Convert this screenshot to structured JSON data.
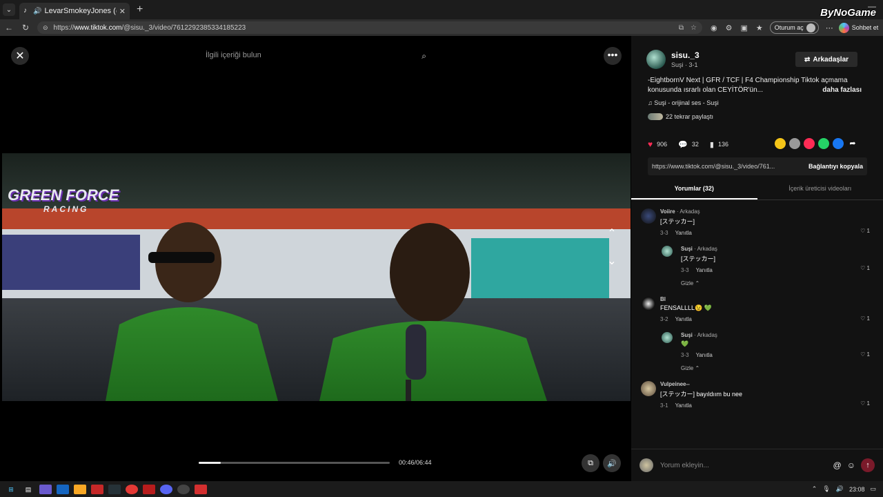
{
  "browser": {
    "tab_title": "LevarSmokeyJones (@levarsmo",
    "url_prefix": "https://",
    "url_host": "www.tiktok.com",
    "url_path": "/@sisu._3/video/7612292385334185223",
    "signin_label": "Oturum aç",
    "chat_label": "Sohbet et",
    "brand_watermark": "ByNoGame"
  },
  "player": {
    "search_placeholder": "İlgili içeriği bulun",
    "time": "00:46/06:44",
    "progress_fraction": 0.115
  },
  "video_overlay": {
    "logo_line1": "GREEN FORCE",
    "logo_line2": "RACING"
  },
  "sidebar": {
    "author_name": "sisu._3",
    "author_sub": "Suşi · 3-1",
    "friends_label": "Arkadaşlar",
    "description": "-EightbornV Next | GFR / TCF | F4 Championship Tiktok açmama konusunda ısrarlı olan CEYİTÖR'ün...",
    "more_label": "daha fazlası",
    "music": "Suşi - orijinal ses - Suşi",
    "reposts": "22 tekrar paylaştı",
    "likes": "906",
    "comments_count": "32",
    "saves": "136",
    "link": "https://www.tiktok.com/@sisu._3/video/761...",
    "copy_link": "Bağlantıyı kopyala",
    "tab_comments": "Yorumlar (32)",
    "tab_creator": "İçerik üreticisi videoları"
  },
  "comments": [
    {
      "user": "Voiire",
      "tag": "· Arkadaş",
      "text": "[ステッカー]",
      "date": "3-3",
      "reply": "Yanıtla",
      "likes": "1"
    },
    {
      "user": "Suşi",
      "tag": "· Arkadaş",
      "text": "[ステッカー]",
      "date": "3-3",
      "reply": "Yanıtla",
      "likes": "1"
    },
    {
      "user": "Bl",
      "tag": "",
      "text": "FENSALLLL😉 💚",
      "date": "3-2",
      "reply": "Yanıtla",
      "likes": "1"
    },
    {
      "user": "Suşi",
      "tag": "· Arkadaş",
      "text": "💚",
      "date": "3-3",
      "reply": "Yanıtla",
      "likes": "1"
    },
    {
      "user": "Vulpeinee--",
      "tag": "",
      "text": "[ステッカー] bayıldıım bu nee",
      "date": "3-1",
      "reply": "Yanıtla",
      "likes": "1"
    }
  ],
  "hide_label": "Gizle",
  "comment_input_placeholder": "Yorum ekleyin...",
  "taskbar": {
    "time": "23:08"
  },
  "colors": {
    "like_heart": "#fe2c55",
    "send": "#7a1a2a"
  }
}
